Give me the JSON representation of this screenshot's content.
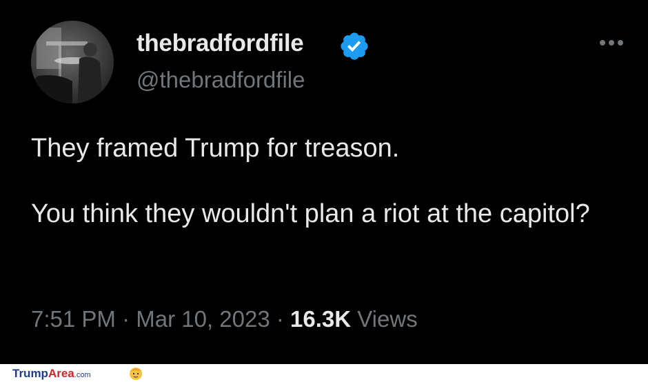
{
  "tweet": {
    "display_name": "thebradfordfile",
    "handle": "@thebradfordfile",
    "verified_icon": "verified-badge-icon",
    "more_icon": "more-options-icon",
    "text_lines": [
      "They framed Trump for treason.",
      "You think they wouldn't plan a riot at the capitol?"
    ],
    "time": "7:51 PM",
    "sep1": " · ",
    "date": "Mar 10, 2023",
    "sep2": " · ",
    "views_count": "16.3K",
    "views_label": "Views"
  },
  "footer": {
    "brand_part1": "Trump",
    "brand_part2": "Area",
    "brand_part3": ".com"
  },
  "colors": {
    "background": "#000000",
    "primary_text": "#e7e9ea",
    "secondary_text": "#71767b",
    "verified_blue": "#1d9bf0"
  }
}
